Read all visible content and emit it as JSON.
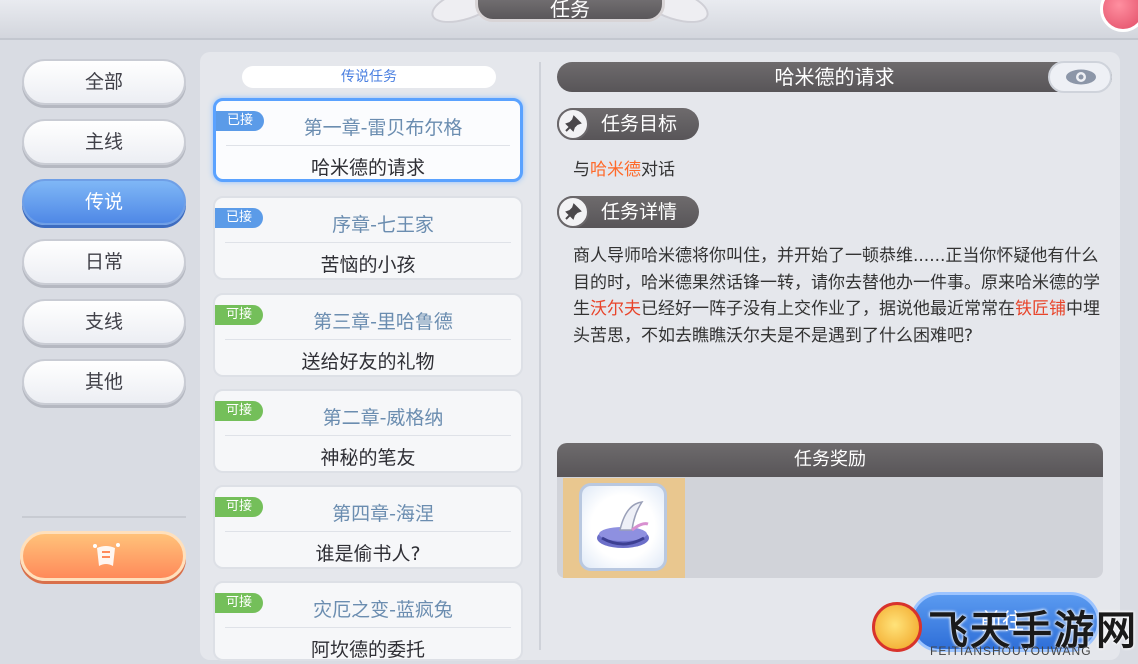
{
  "header": {
    "title": "任务"
  },
  "categories": [
    {
      "label": "全部",
      "active": false
    },
    {
      "label": "主线",
      "active": false
    },
    {
      "label": "传说",
      "active": true
    },
    {
      "label": "日常",
      "active": false
    },
    {
      "label": "支线",
      "active": false
    },
    {
      "label": "其他",
      "active": false
    }
  ],
  "quest_list": {
    "header": "传说任务",
    "items": [
      {
        "status": "已接",
        "chapter": "第一章-雷贝布尔格",
        "name": "哈米德的请求"
      },
      {
        "status": "已接",
        "chapter": "序章-七王家",
        "name": "苦恼的小孩"
      },
      {
        "status": "可接",
        "chapter": "第三章-里哈鲁德",
        "name": "送给好友的礼物"
      },
      {
        "status": "可接",
        "chapter": "第二章-威格纳",
        "name": "神秘的笔友"
      },
      {
        "status": "可接",
        "chapter": "第四章-海涅",
        "name": "谁是偷书人?"
      },
      {
        "status": "可接",
        "chapter": "灾厄之变-蓝疯兔",
        "name": "阿坎德的委托"
      }
    ]
  },
  "detail": {
    "title": "哈米德的请求",
    "objective_label": "任务目标",
    "objective": {
      "prefix": "与",
      "highlight": "哈米德",
      "suffix": "对话"
    },
    "detail_label": "任务详情",
    "description": {
      "part1": "商人导师哈米德将你叫住，并开始了一顿恭维......正当你怀疑他有什么目的时，哈米德果然话锋一转，请你去替他办一件事。原来哈米德的学生",
      "highlight1": "沃尔夫",
      "part2": "已经好一阵子没有上交作业了，据说他最近常常在",
      "highlight2": "铁匠铺",
      "part3": "中埋头苦思，不如去瞧瞧沃尔夫是不是遇到了什么困难吧?"
    },
    "reward_label": "任务奖励",
    "claim_button": "前往"
  },
  "watermark": {
    "text": "飞天手游网",
    "sub": "FEITIANSHOUYOUWANG"
  },
  "colors": {
    "accent_blue": "#4f88e6",
    "highlight_orange": "#ff6a2a",
    "tag_accepted": "#5b9be8",
    "tag_available": "#74bf5a"
  }
}
